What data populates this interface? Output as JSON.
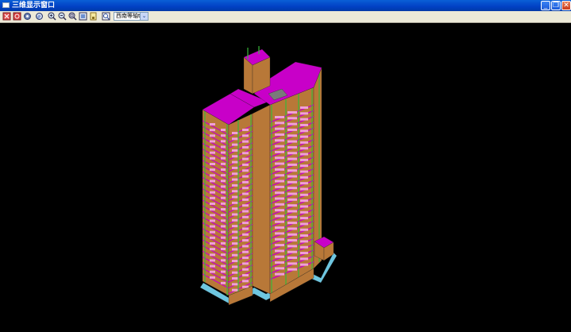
{
  "window": {
    "title": "三维显示窗口"
  },
  "titlebar_buttons": {
    "minimize": "_",
    "restore": "❐",
    "close": "✕"
  },
  "toolbar": {
    "tools": [
      "delete-icon",
      "refresh-icon",
      "settings-icon",
      "rotate-icon",
      "zoom-in-icon",
      "zoom-out-icon",
      "zoom-window-icon",
      "zoom-extents-icon",
      "save-icon",
      "print-preview-icon"
    ],
    "view_select": {
      "value": "西南等轴t",
      "arrow": "⌄"
    }
  },
  "colors": {
    "titlebar": "#0a5fd6",
    "background": "#000000",
    "slab": "#c800c8",
    "wall": "#b87838",
    "column": "#39b839",
    "window": "#f0a0d8",
    "base": "#6ec6e0"
  }
}
